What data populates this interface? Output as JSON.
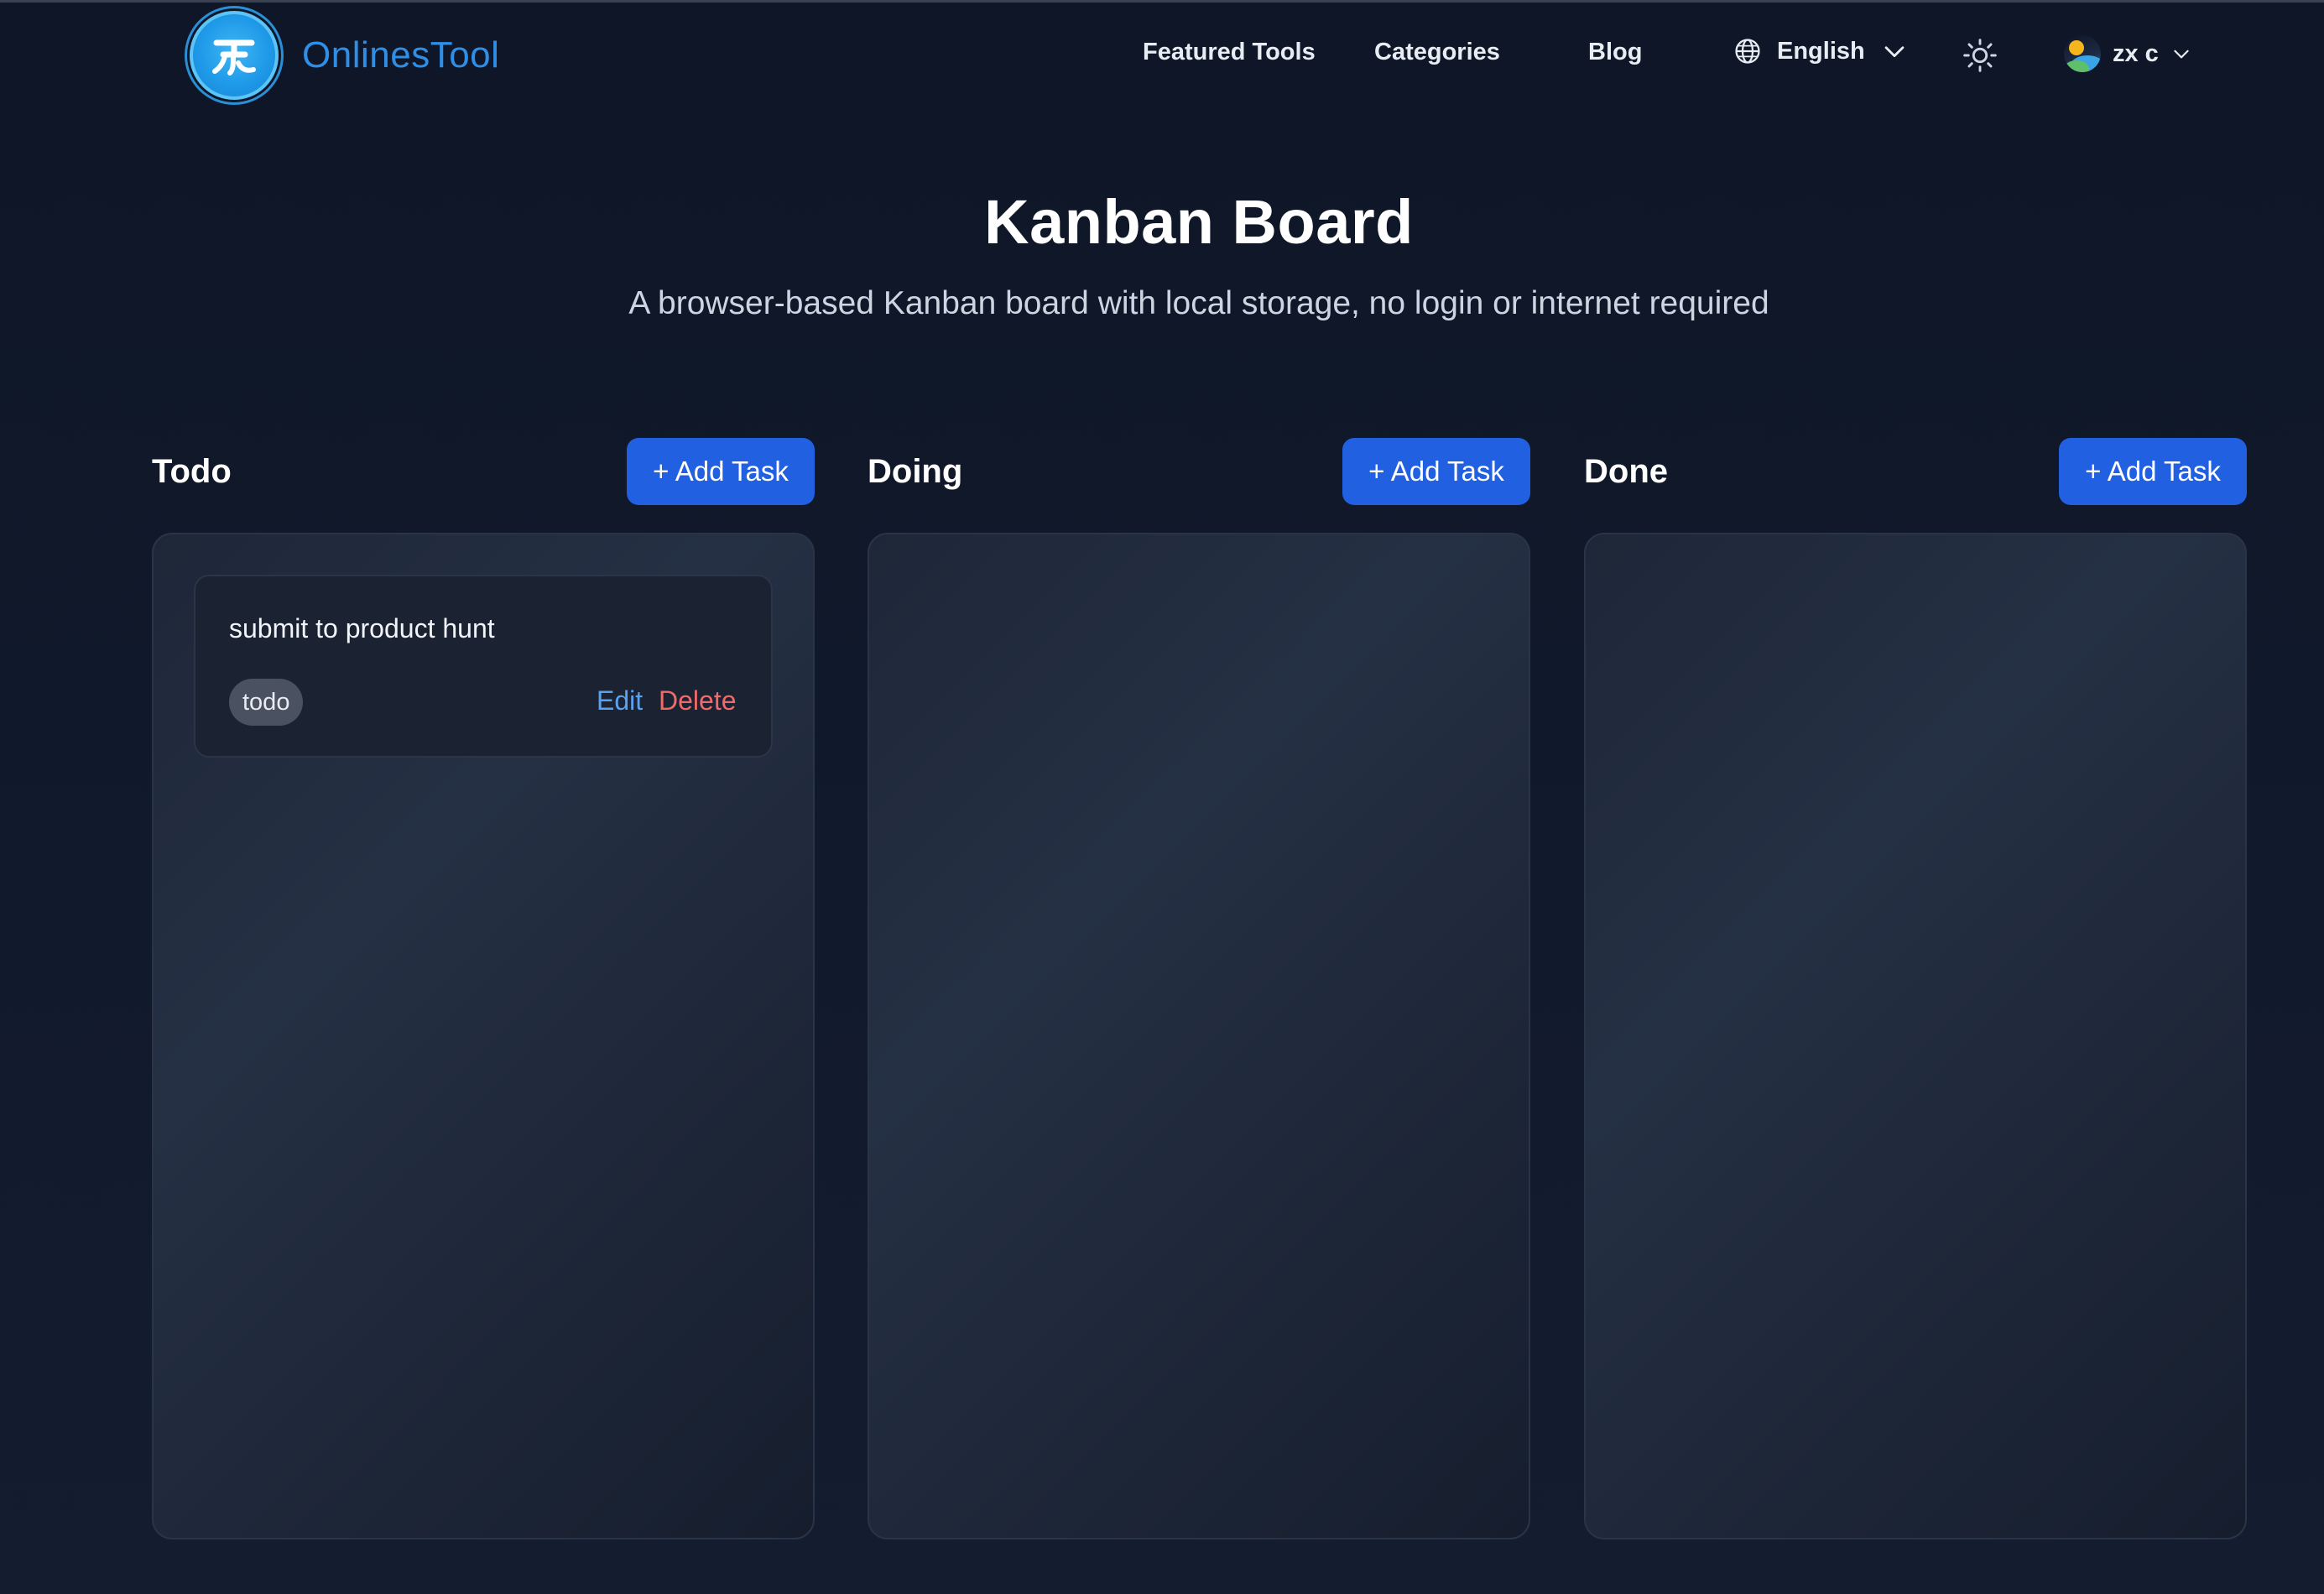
{
  "brand": {
    "name": "OnlinesTool",
    "logo_icon": "onlinestool-logo-icon"
  },
  "nav": {
    "links": [
      "Featured Tools",
      "Categories",
      "Blog"
    ],
    "language": "English",
    "theme_icon": "sun-icon",
    "user": "zx c"
  },
  "hero": {
    "title": "Kanban Board",
    "subtitle": "A browser-based Kanban board with local storage, no login or internet required"
  },
  "board": {
    "add_label": "+ Add Task",
    "columns": [
      {
        "title": "Todo",
        "tasks": [
          {
            "text": "submit to product hunt",
            "tag": "todo",
            "edit": "Edit",
            "delete": "Delete"
          }
        ]
      },
      {
        "title": "Doing",
        "tasks": []
      },
      {
        "title": "Done",
        "tasks": []
      }
    ]
  },
  "colors": {
    "background": "#0e1627",
    "accent_button": "#2160e0",
    "brand_text": "#2f8ee6",
    "edit_link": "#5aa2f0",
    "delete_link": "#f06a6a"
  }
}
